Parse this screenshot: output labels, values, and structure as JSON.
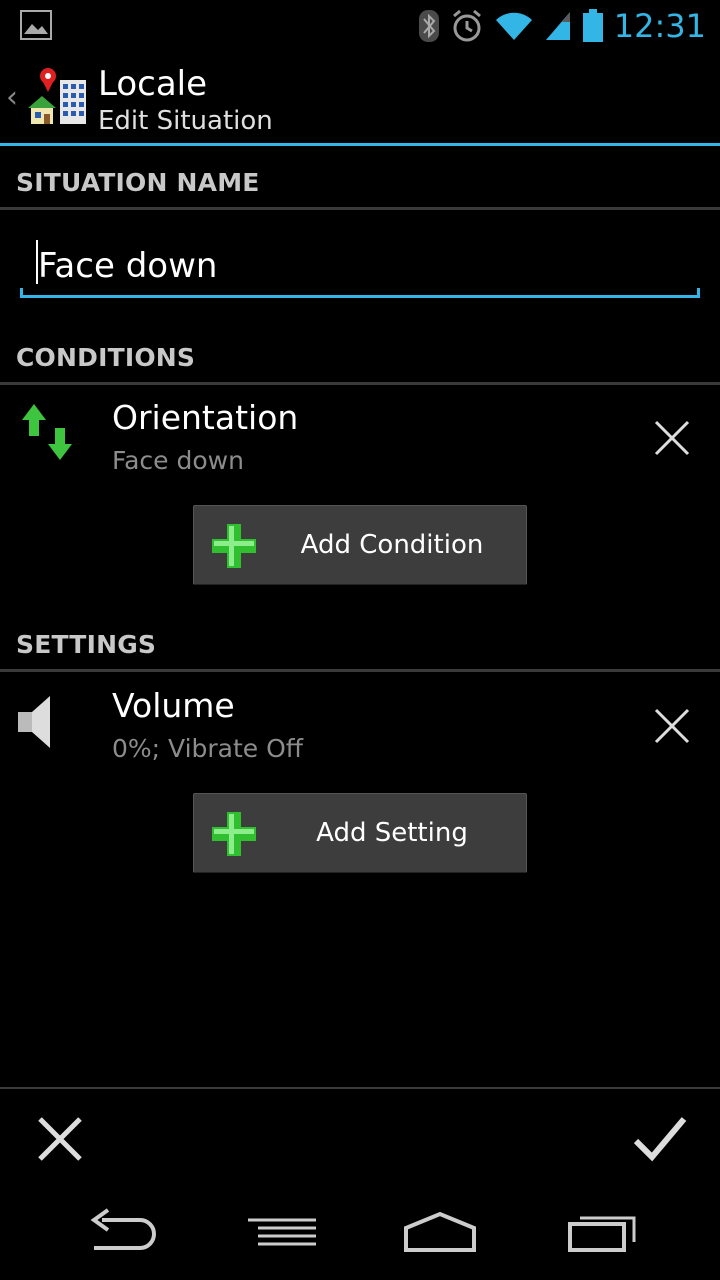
{
  "status_bar": {
    "time": "12:31",
    "icons": [
      "gallery-icon",
      "bluetooth-icon",
      "alarm-icon",
      "wifi-icon",
      "signal-icon",
      "battery-icon"
    ],
    "accent_color": "#33b5e5"
  },
  "action_bar": {
    "title": "Locale",
    "subtitle": "Edit Situation",
    "back_icon": "chevron-left-icon",
    "app_icon": "locale-app-icon"
  },
  "situation_name": {
    "header": "SITUATION NAME",
    "value": "Face down"
  },
  "conditions": {
    "header": "CONDITIONS",
    "items": [
      {
        "label": "Orientation",
        "value": "Face down",
        "icon": "orientation-arrows-icon"
      }
    ],
    "add_label": "Add Condition"
  },
  "settings": {
    "header": "SETTINGS",
    "items": [
      {
        "label": "Volume",
        "value": "0%; Vibrate Off",
        "icon": "speaker-icon"
      }
    ],
    "add_label": "Add Setting"
  },
  "footer": {
    "cancel_icon": "close-icon",
    "done_icon": "checkmark-icon"
  },
  "nav_bar": {
    "icons": [
      "back-icon",
      "menu-icon",
      "home-icon",
      "recent-apps-icon"
    ]
  }
}
